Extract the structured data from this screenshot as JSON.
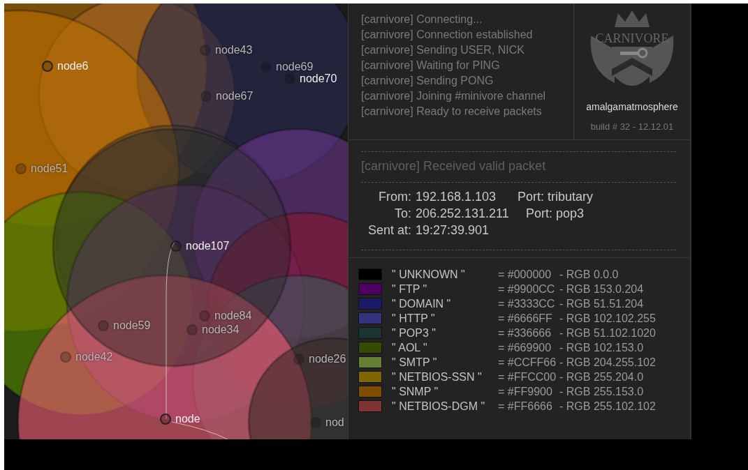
{
  "graph": {
    "nodes": [
      {
        "label": "node6",
        "highlighted": true
      },
      {
        "label": "node43",
        "highlighted": false
      },
      {
        "label": "node69",
        "highlighted": false
      },
      {
        "label": "node70",
        "highlighted": true
      },
      {
        "label": "node67",
        "highlighted": false
      },
      {
        "label": "node51",
        "highlighted": false
      },
      {
        "label": "node107",
        "highlighted": true
      },
      {
        "label": "node84",
        "highlighted": false
      },
      {
        "label": "node59",
        "highlighted": false
      },
      {
        "label": "node34",
        "highlighted": false
      },
      {
        "label": "node42",
        "highlighted": false
      },
      {
        "label": "node26",
        "highlighted": false
      },
      {
        "label": "node",
        "highlighted": true
      },
      {
        "label": "nod",
        "highlighted": false
      }
    ]
  },
  "log": {
    "lines": [
      "[carnivore] Connecting...",
      "[carnivore] Connection established",
      "[carnivore] Sending USER, NICK",
      "[carnivore] Waiting for PING",
      "[carnivore] Sending PONG",
      "[carnivore] Joining #minivore channel",
      "[carnivore] Ready to receive packets"
    ]
  },
  "profile": {
    "logo_text": "CARNIVORE",
    "username": "amalgamatmosphere",
    "build": "build # 32 - 12.12.01"
  },
  "packet": {
    "title": "[carnivore] Received valid packet",
    "rows": [
      {
        "label": "From:",
        "value": "192.168.1.103",
        "port": "Port: tributary"
      },
      {
        "label": "To:",
        "value": "206.252.131.211",
        "port": "Port: pop3"
      },
      {
        "label": "Sent at:",
        "value": "19:27:39.901"
      }
    ]
  },
  "legend": [
    {
      "name": "\" UNKNOWN \"",
      "hex": "= #000000",
      "rgb": "- RGB 0.0.0",
      "color": "#000000"
    },
    {
      "name": "\" FTP \"",
      "hex": "= #9900CC",
      "rgb": "- RGB 153.0.204",
      "color": "#4c0066"
    },
    {
      "name": "\" DOMAIN \"",
      "hex": "= #3333CC",
      "rgb": "- RGB 51.51.204",
      "color": "#1a1a66"
    },
    {
      "name": "\" HTTP \"",
      "hex": "= #6666FF",
      "rgb": "- RGB 102.102.255",
      "color": "#333380"
    },
    {
      "name": "\" POP3 \"",
      "hex": "= #336666",
      "rgb": "- RGB 51.102.1020",
      "color": "#1a3333"
    },
    {
      "name": "\" AOL \"",
      "hex": "= #669900",
      "rgb": "- RGB 102.153.0",
      "color": "#334c00"
    },
    {
      "name": "\" SMTP \"",
      "hex": "= #CCFF66",
      "rgb": "- RGB 204.255.102",
      "color": "#668033"
    },
    {
      "name": "\" NETBIOS-SSN \"",
      "hex": "= #FFCC00",
      "rgb": "- RGB 255.204.0",
      "color": "#806600"
    },
    {
      "name": "\" SNMP \"",
      "hex": "= #FF9900",
      "rgb": "- RGB 255.153.0",
      "color": "#804c00"
    },
    {
      "name": "\" NETBIOS-DGM \"",
      "hex": "= #FF6666",
      "rgb": "- RGB 255.102.102",
      "color": "#803333"
    }
  ]
}
